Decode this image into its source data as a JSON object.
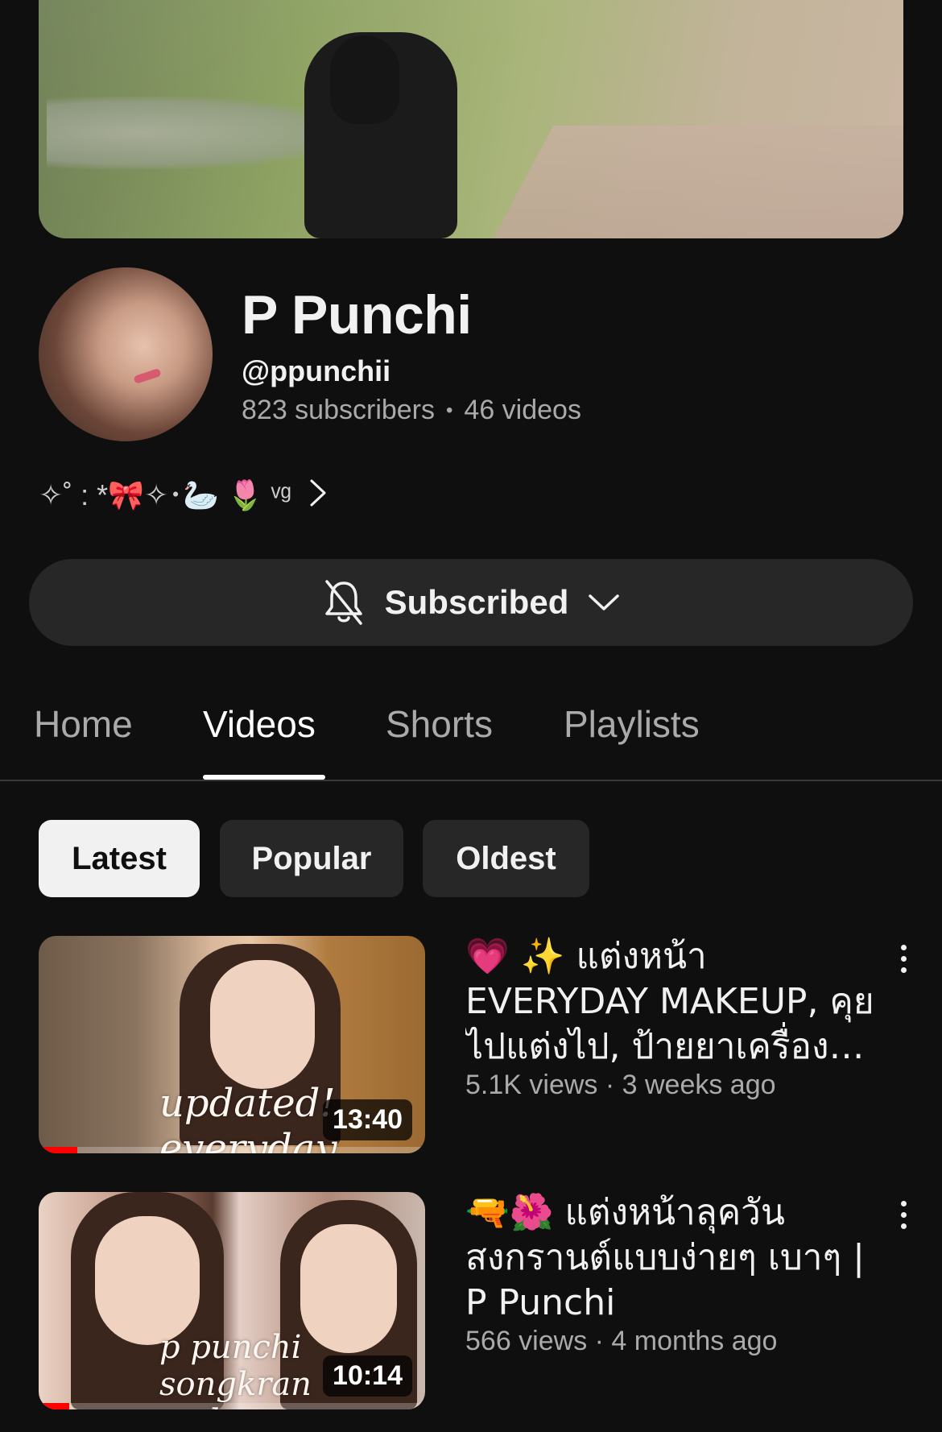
{
  "channel": {
    "name": "P Punchi",
    "handle": "@ppunchii",
    "subscribers": "823 subscribers",
    "separator": "•",
    "videos": "46 videos",
    "bio": "✧˚ : *🎀✧･🦢 🌷 ᵛᵍ"
  },
  "subscribe_button": {
    "label": "Subscribed",
    "bell_icon": "bell-off-icon",
    "chevron_icon": "chevron-down-icon"
  },
  "tabs": [
    {
      "label": "Home",
      "active": false
    },
    {
      "label": "Videos",
      "active": true
    },
    {
      "label": "Shorts",
      "active": false
    },
    {
      "label": "Playlists",
      "active": false
    }
  ],
  "chips": [
    {
      "label": "Latest",
      "active": true
    },
    {
      "label": "Popular",
      "active": false
    },
    {
      "label": "Oldest",
      "active": false
    }
  ],
  "videos": [
    {
      "title": "💗 ✨ แต่งหน้า EVERYDAY MAKEUP, คุยไปแต่งไป, ป้ายยาเครื่องสำอาง",
      "meta": "5.1K views · 3 weeks ago",
      "duration": "13:40",
      "watched_fraction": 0.1,
      "thumb_text": "updated! everyday makeup"
    },
    {
      "title": "🔫🌺 แต่งหน้าลุควัน สงกรานต์แบบง่ายๆ เบาๆ | P Punchi",
      "meta": "566 views · 4 months ago",
      "duration": "10:14",
      "watched_fraction": 0.08,
      "thumb_text": "p punchi songkran makeup"
    }
  ],
  "colors": {
    "background": "#0f0f0f",
    "surface": "#272727",
    "text_primary": "#f1f1f1",
    "text_secondary": "#aaaaaa",
    "progress": "#ff0000"
  }
}
